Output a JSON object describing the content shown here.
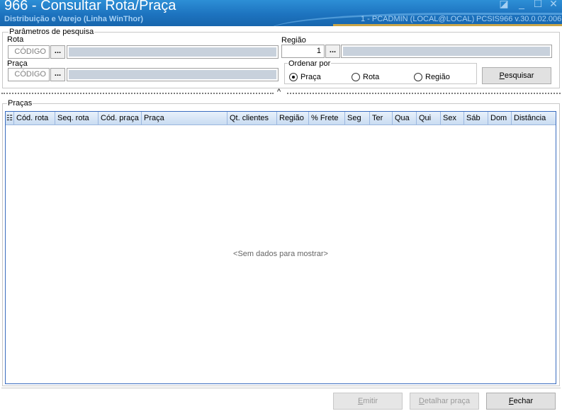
{
  "window": {
    "title": "966 - Consultar Rota/Praça",
    "subtitle": "Distribuição e Varejo (Linha WinThor)",
    "user_info": "1 - PCADMIN (LOCAL@LOCAL)",
    "version": "PCSIS966  v.30.0.02.006",
    "controls": [
      "◪",
      "_",
      "☐",
      "✕"
    ]
  },
  "search": {
    "group_title": "Parâmetros de pesquisa",
    "rota_label": "Rota",
    "rota_code_placeholder": "CÓDIGO",
    "praca_label": "Praça",
    "praca_code_placeholder": "CÓDIGO",
    "regiao_label": "Região",
    "regiao_code_value": "1",
    "lookup_button_label": "...",
    "order_group_title": "Ordenar por",
    "order_options": [
      {
        "label": "Praça",
        "selected": true
      },
      {
        "label": "Rota",
        "selected": false
      },
      {
        "label": "Região",
        "selected": false
      }
    ],
    "search_button": {
      "label_underlined": "P",
      "label_rest": "esquisar"
    }
  },
  "splitter": {
    "caret": "^"
  },
  "grid": {
    "group_title": "Praças",
    "columns": [
      "Cód. rota",
      "Seq. rota",
      "Cód. praça",
      "Praça",
      "Qt. clientes",
      "Região",
      "% Frete",
      "Seg",
      "Ter",
      "Qua",
      "Qui",
      "Sex",
      "Sáb",
      "Dom",
      "Distância"
    ],
    "empty_text": "<Sem dados para mostrar>"
  },
  "footer": {
    "emitir": {
      "u": "E",
      "rest": "mitir",
      "enabled": false
    },
    "detalhar": {
      "u": "D",
      "rest": "etalhar praça",
      "enabled": false
    },
    "fechar": {
      "u": "F",
      "rest": "echar",
      "enabled": true
    }
  }
}
